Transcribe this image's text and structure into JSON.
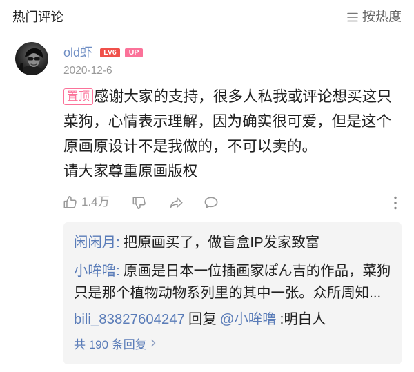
{
  "header": {
    "title": "热门评论",
    "sort_label": "按热度"
  },
  "comment": {
    "username": "old虾",
    "level_badge": "LV6",
    "up_badge": "UP",
    "date": "2020-12-6",
    "pinned_tag": "置顶",
    "content_lines": [
      "感谢大家的支持，很多人私我或评论想买这只",
      "菜狗，心情表示理解，因为确实很可爱，但是这个",
      "原画原设计不是我做的，不可以卖的。",
      "请大家尊重原画版权"
    ],
    "like_count": "1.4万"
  },
  "replies": {
    "items": [
      {
        "user": "闲闲月",
        "sep": ":",
        "lines": [
          "把原画买了，做盲盒IP发家致富"
        ]
      },
      {
        "user": "小哞噜",
        "sep": ":",
        "lines": [
          "原画是日本一位插画家ぽん吉的作品，菜狗",
          "只是那个植物动物系列里的其中一张。众所周知..."
        ]
      },
      {
        "user": "bili_83827604247",
        "action": "回复",
        "mention": "@小哞噜",
        "text": ":明白人"
      }
    ],
    "more_label": "共 190 条回复"
  },
  "icons": {
    "sort": "sort-icon",
    "avatar": "avatar-image",
    "like": "thumbs-up-icon",
    "dislike": "thumbs-down-icon",
    "share": "share-icon",
    "comment": "comment-icon",
    "more": "more-vertical-icon",
    "more_replies": "chevron-right-icon"
  },
  "colors": {
    "text": "#212121",
    "muted": "#999999",
    "link_blue": "#5a7cb8",
    "username_blue": "#6f8ec4",
    "accent_pink": "#fb7299",
    "level_red": "#f0504a",
    "reply_bg": "#f4f4f4"
  }
}
